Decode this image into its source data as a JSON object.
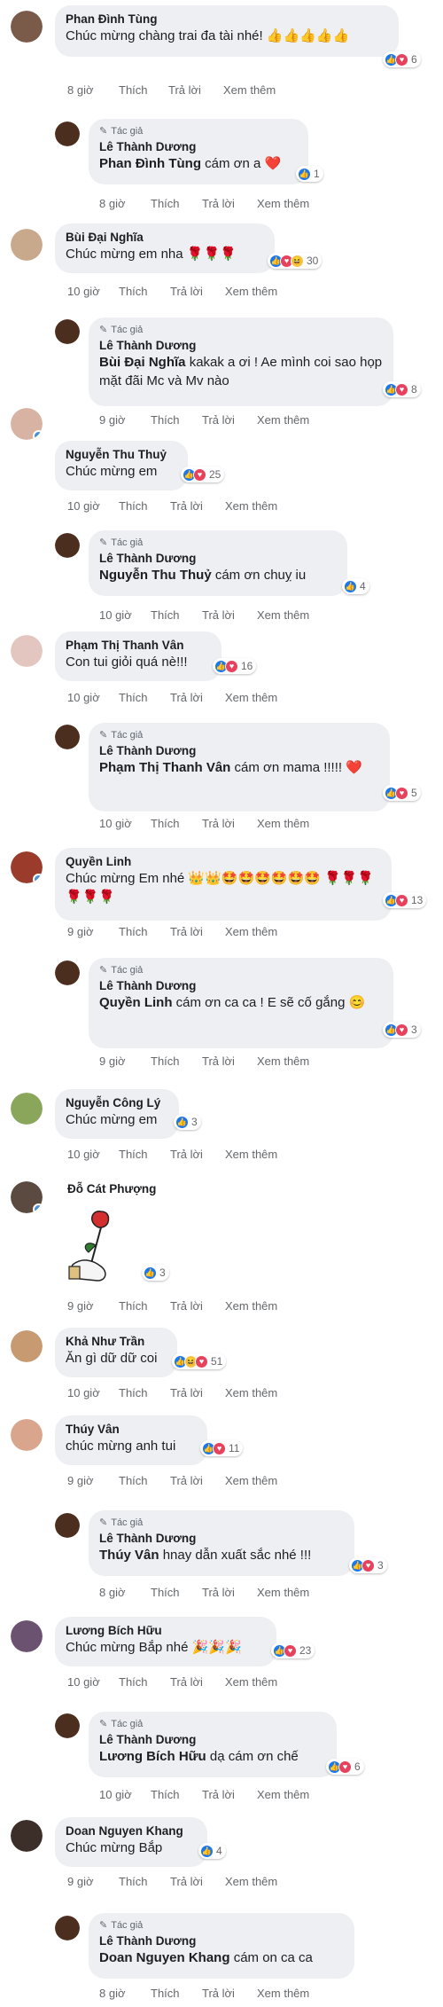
{
  "labels": {
    "like": "Thích",
    "reply": "Trả lời",
    "more": "Xem thêm",
    "author_tag": "Tác giả"
  },
  "comments": [
    {
      "name": "Phan Đình Tùng",
      "text": "Chúc mừng chàng trai đa tài nhé! 👍👍👍👍👍",
      "time": "8 giờ",
      "reactions": "6"
    },
    {
      "name": "Lê Thành Dương",
      "mention": "Phan Đình Tùng",
      "text": "cám ơn a ❤️",
      "time": "8 giờ",
      "reactions": "1"
    },
    {
      "name": "Bùi Đại Nghĩa",
      "text": "Chúc mừng em nha 🌹🌹🌹",
      "time": "10 giờ",
      "reactions": "30"
    },
    {
      "name": "Lê Thành Dương",
      "mention": "Bùi Đại Nghĩa",
      "text": "kakak a ơi ! Ae mình coi sao họp mặt đãi Mc và Mv nào",
      "time": "9 giờ",
      "reactions": "8"
    },
    {
      "name": "Nguyễn Thu Thuỷ",
      "text": "Chúc mừng em",
      "time": "10 giờ",
      "reactions": "25"
    },
    {
      "name": "Lê Thành Dương",
      "mention": "Nguyễn Thu Thuỷ",
      "text": "cám ơn chuỵ iu",
      "time": "10 giờ",
      "reactions": "4"
    },
    {
      "name": "Phạm Thị Thanh Vân",
      "text": "Con tui giỏi quá nè!!!",
      "time": "10 giờ",
      "reactions": "16"
    },
    {
      "name": "Lê Thành Dương",
      "mention": "Phạm Thị Thanh Vân",
      "text": "cám ơn mama !!!!! ❤️",
      "time": "10 giờ",
      "reactions": "5"
    },
    {
      "name": "Quyền Linh",
      "text": "Chúc mừng Em nhé 👑👑🤩🤩🤩🤩🤩🤩 🌹🌹🌹🌹🌹🌹",
      "time": "9 giờ",
      "reactions": "13"
    },
    {
      "name": "Lê Thành Dương",
      "mention": "Quyền Linh",
      "text": "cám ơn ca ca ! E sẽ cố gắng 😊",
      "time": "9 giờ",
      "reactions": "3"
    },
    {
      "name": "Nguyễn Công Lý",
      "text": "Chúc mừng em",
      "time": "10 giờ",
      "reactions": "3"
    },
    {
      "name": "Đỗ Cát Phượng",
      "text": "",
      "time": "9 giờ",
      "reactions": "3"
    },
    {
      "name": "Khả Như Trần",
      "text": "Ăn gì dữ dữ coi",
      "time": "10 giờ",
      "reactions": "51"
    },
    {
      "name": "Thúy Vân",
      "text": "chúc mừng anh tui",
      "time": "9 giờ",
      "reactions": "11"
    },
    {
      "name": "Lê Thành Dương",
      "mention": "Thúy Vân",
      "text": "hnay dẫn xuất sắc nhé !!!",
      "time": "8 giờ",
      "reactions": "3"
    },
    {
      "name": "Lương Bích Hữu",
      "text": "Chúc mừng Bắp nhé 🎉🎉🎉",
      "time": "10 giờ",
      "reactions": "23"
    },
    {
      "name": "Lê Thành Dương",
      "mention": "Lương Bích Hữu",
      "text": "dạ cám ơn chế",
      "time": "10 giờ",
      "reactions": "6"
    },
    {
      "name": "Doan Nguyen Khang",
      "text": "Chúc mừng Bắp",
      "time": "9 giờ",
      "reactions": "4"
    },
    {
      "name": "Lê Thành Dương",
      "mention": "Doan Nguyen Khang",
      "text": "cám on ca ca",
      "time": "8 giờ",
      "reactions": ""
    }
  ],
  "colors": {
    "like": "#1877f2",
    "love": "#e8415b",
    "bubble": "#eeeff2",
    "meta": "#65676b"
  }
}
